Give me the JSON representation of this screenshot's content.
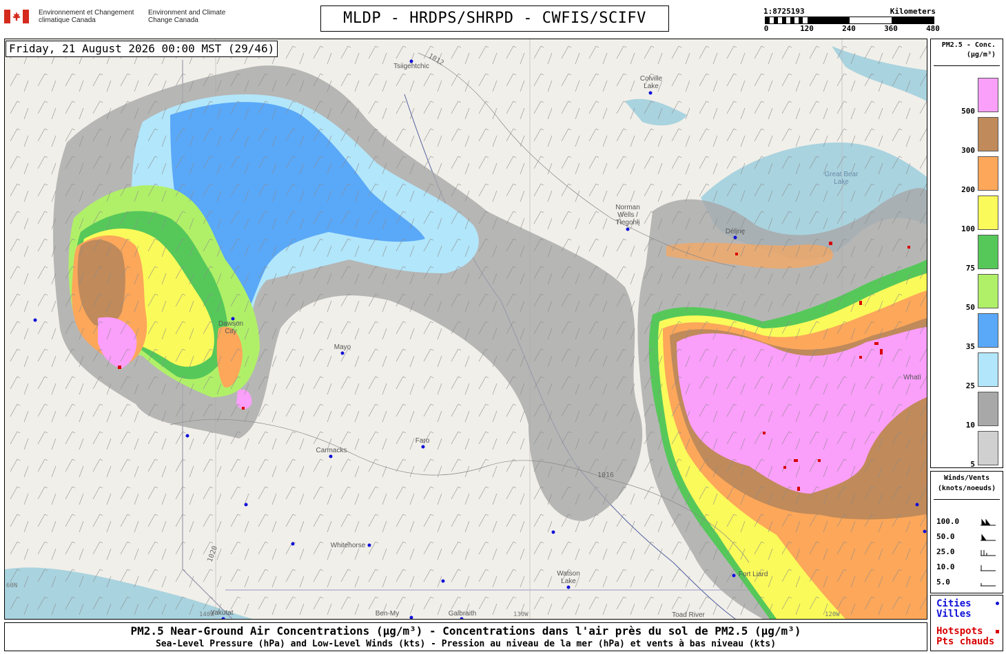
{
  "header": {
    "gov_fr": "Environnement et Changement climatique Canada",
    "gov_en": "Environment and Climate Change Canada",
    "title": "MLDP - HRDPS/SHRPD - CWFIS/SCIFV",
    "scale": {
      "ratio": "1:8725193",
      "unit": "Kilometers",
      "ticks": [
        "0",
        "120",
        "240",
        "360",
        "480"
      ]
    }
  },
  "map": {
    "timestamp": "Friday, 21 August 2026 00:00 MST (29/46)",
    "cities": [
      {
        "name": "Tsiigehtchic"
      },
      {
        "name": "Colville Lake"
      },
      {
        "name": "Norman Wells / Tłegohłį"
      },
      {
        "name": "Délįnę"
      },
      {
        "name": "Dawson City"
      },
      {
        "name": "Mayo"
      },
      {
        "name": "Carmacks"
      },
      {
        "name": "Faro"
      },
      {
        "name": "Whitehorse"
      },
      {
        "name": "Watson Lake"
      },
      {
        "name": "Yakutat"
      },
      {
        "name": "Galbraith"
      },
      {
        "name": "Ben-My"
      },
      {
        "name": "Toad River"
      },
      {
        "name": "Fort Liard"
      },
      {
        "name": "Whatì"
      }
    ],
    "water_labels": [
      "Great Bear Lake"
    ],
    "graticule_labels": [
      "140W",
      "130W",
      "120W",
      "60N"
    ],
    "isobar_labels": [
      "1012",
      "1016",
      "1020"
    ],
    "colors": {
      "city": "#1010d8",
      "hotspot": "#d80000",
      "land": "#f1efe9",
      "water": "#a9d3df"
    }
  },
  "legend_pm": {
    "title_1": "PM2.5 - Conc.",
    "title_2": "(µg/m³)",
    "bins": [
      {
        "label": "500",
        "color": "#fa9ffa"
      },
      {
        "label": "300",
        "color": "#c08a5a"
      },
      {
        "label": "200",
        "color": "#fca75a"
      },
      {
        "label": "100",
        "color": "#fafa5a"
      },
      {
        "label": "75",
        "color": "#56c85a"
      },
      {
        "label": "50",
        "color": "#b0f068"
      },
      {
        "label": "35",
        "color": "#5aa8f8"
      },
      {
        "label": "25",
        "color": "#b2e6fa"
      },
      {
        "label": "10",
        "color": "#a8a8a8"
      },
      {
        "label": "5",
        "color": "#d0d0d0"
      }
    ]
  },
  "legend_wind": {
    "title_1": "Winds/Vents",
    "title_2": "(knots/noeuds)",
    "rows": [
      "100.0",
      "50.0",
      "25.0",
      "10.0",
      "5.0"
    ]
  },
  "legend_points": {
    "cities_1": "Cities",
    "cities_2": "Villes",
    "hot_1": "Hotspots",
    "hot_2": "Pts chauds"
  },
  "footer": {
    "line1": "PM2.5 Near-Ground Air Concentrations (µg/m³) - Concentrations dans l'air près du sol de PM2.5 (µg/m³)",
    "line2": "Sea-Level Pressure (hPa) and Low-Level Winds (kts) - Pression au niveau de la mer (hPa) et vents à bas niveau (kts)"
  }
}
